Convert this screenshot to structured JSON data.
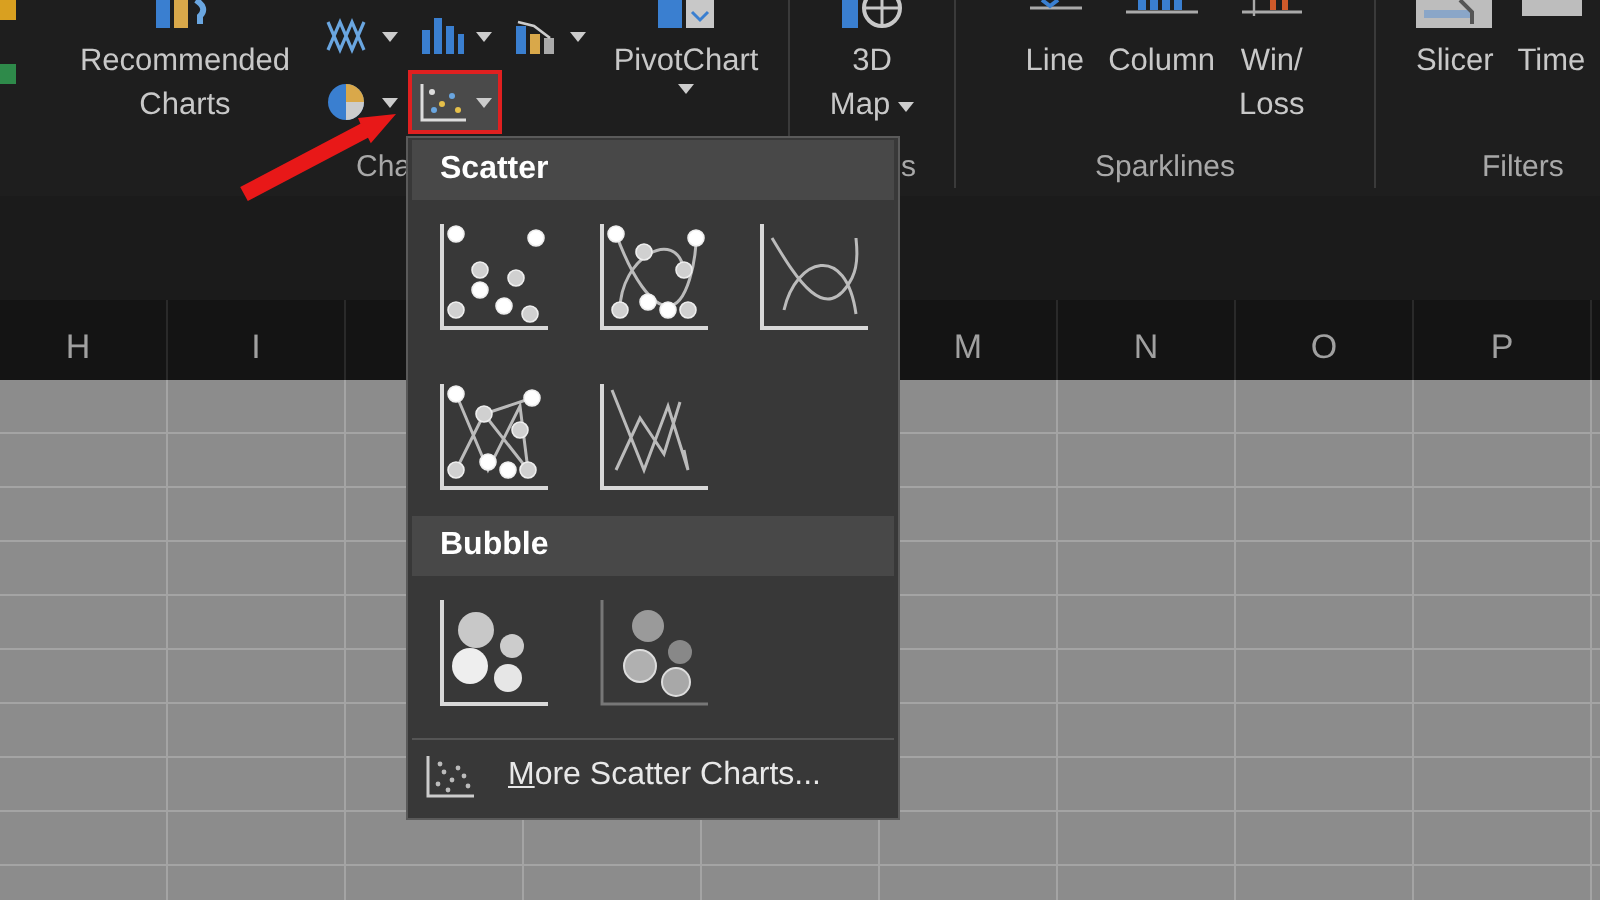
{
  "ribbon": {
    "charts_group": {
      "label": "Cha",
      "recommended": {
        "lines": [
          "Recommended",
          "Charts"
        ]
      },
      "small_buttons": [
        {
          "kind": "line",
          "highlighted": false
        },
        {
          "kind": "column",
          "highlighted": false
        },
        {
          "kind": "combo",
          "highlighted": false
        },
        {
          "kind": "pie",
          "highlighted": false
        },
        {
          "kind": "scatter",
          "highlighted": true
        }
      ],
      "pivot": {
        "label": "PivotChart"
      }
    },
    "tours_group": {
      "label": "s",
      "map": {
        "lines": [
          "3D",
          "Map"
        ]
      }
    },
    "sparklines_group": {
      "label": "Sparklines",
      "buttons": [
        {
          "kind": "line",
          "lines": [
            "Line"
          ]
        },
        {
          "kind": "column",
          "lines": [
            "Column"
          ]
        },
        {
          "kind": "winloss",
          "lines": [
            "Win/",
            "Loss"
          ]
        }
      ]
    },
    "filters_group": {
      "label": "Filters",
      "buttons": [
        {
          "kind": "slicer",
          "lines": [
            "Slicer"
          ]
        },
        {
          "kind": "timeline",
          "lines": [
            "Time"
          ]
        }
      ]
    }
  },
  "columns": [
    "H",
    "I",
    "M",
    "N",
    "O",
    "P"
  ],
  "dropdown": {
    "sections": [
      {
        "title": "Scatter",
        "items": [
          {
            "kind": "markers"
          },
          {
            "kind": "smooth_markers"
          },
          {
            "kind": "smooth_lines"
          },
          {
            "kind": "straight_markers"
          },
          {
            "kind": "straight_lines"
          }
        ]
      },
      {
        "title": "Bubble",
        "items": [
          {
            "kind": "bubble"
          },
          {
            "kind": "bubble_3d"
          }
        ]
      }
    ],
    "footer": {
      "access_key": "M",
      "label_rest": "ore Scatter Charts..."
    }
  }
}
